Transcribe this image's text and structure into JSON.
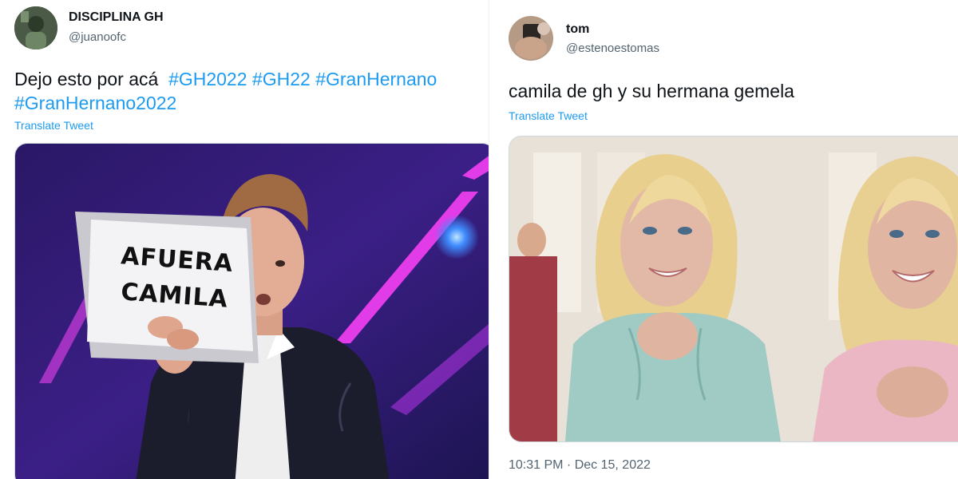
{
  "left_tweet": {
    "display_name": "DISCIPLINA GH",
    "handle": "@juanoofc",
    "text_plain": "Dejo esto por acá",
    "hashtag_1": "#GH2022",
    "hashtag_2": "#GH22",
    "hashtag_3": "#GranHernano",
    "hashtag_4": "#GranHernano2022",
    "translate_label": "Translate Tweet",
    "image": {
      "sign_line_1": "AFUERA",
      "sign_line_2": "CAMILA"
    }
  },
  "right_tweet": {
    "display_name": "tom",
    "handle": "@estenoestomas",
    "text": "camila de gh y su hermana gemela",
    "translate_label": "Translate Tweet",
    "timestamp": "10:31 PM · Dec 15, 2022"
  },
  "colors": {
    "link": "#1d9bf0",
    "secondary_text": "#536471",
    "primary_text": "#0f1419",
    "stage_purple": "#3b1f86",
    "neon_pink": "#e23ce8"
  }
}
